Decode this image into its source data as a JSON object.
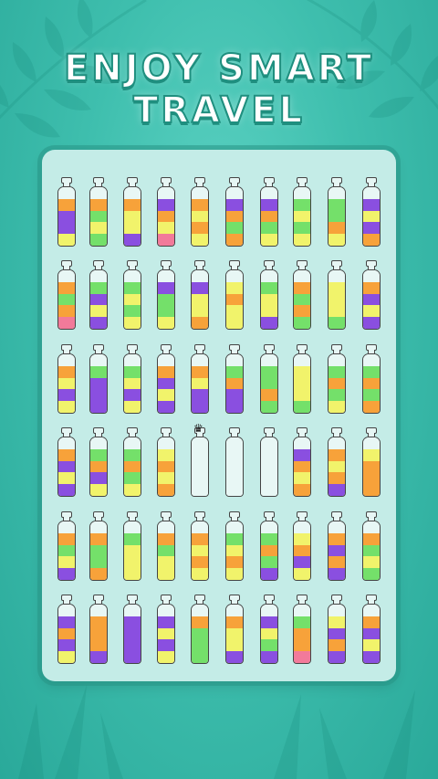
{
  "header": {
    "title_line1": "ENJOY SMART",
    "title_line2": "TRAVEL"
  },
  "palette": {
    "P": "#8a4fe0",
    "Y": "#f1f36b",
    "O": "#f7a23a",
    "G": "#74e06a",
    "K": "#f27a9a",
    "E": "#e8f7f5"
  },
  "board": {
    "rows": [
      [
        "EOPPY",
        "EOGYG",
        "EOYYP",
        "EPOYK",
        "EOYOY",
        "EPOGO",
        "EPOGY",
        "EGYGY",
        "EGGOY",
        "EPYPO"
      ],
      [
        "EOGOK",
        "EGPYP",
        "EGYGY",
        "EPGGY",
        "EPYYO",
        "EYOYY",
        "EGYYP",
        "EOGOG",
        "EYYYG",
        "EOPYP"
      ],
      [
        "EOYPY",
        "EGPPP",
        "EGYPY",
        "EOPYP",
        "EOYPP",
        "EGOPP",
        "EGGOG",
        "EYYYG",
        "EGOGY",
        "EGOGO"
      ],
      [
        "EOPYP",
        "EGOPY",
        "EGOGY",
        "EYOYO",
        "EEEEE",
        "EEEEE",
        "EEEEE",
        "EPOYO",
        "EOYOP",
        "EYOOO"
      ],
      [
        "EOGYP",
        "EOGGO",
        "EGYYY",
        "EOGYY",
        "EOYOY",
        "EGYOY",
        "EGOGP",
        "EYOPY",
        "EOPOP",
        "EOGYG"
      ],
      [
        "EPOPY",
        "EOOOP",
        "EPPPP",
        "EPYPY",
        "EOGGG",
        "EOYYP",
        "EPYGP",
        "EGOOK",
        "EYPOP",
        "EOPYP"
      ]
    ],
    "cursor_label": "♛"
  }
}
